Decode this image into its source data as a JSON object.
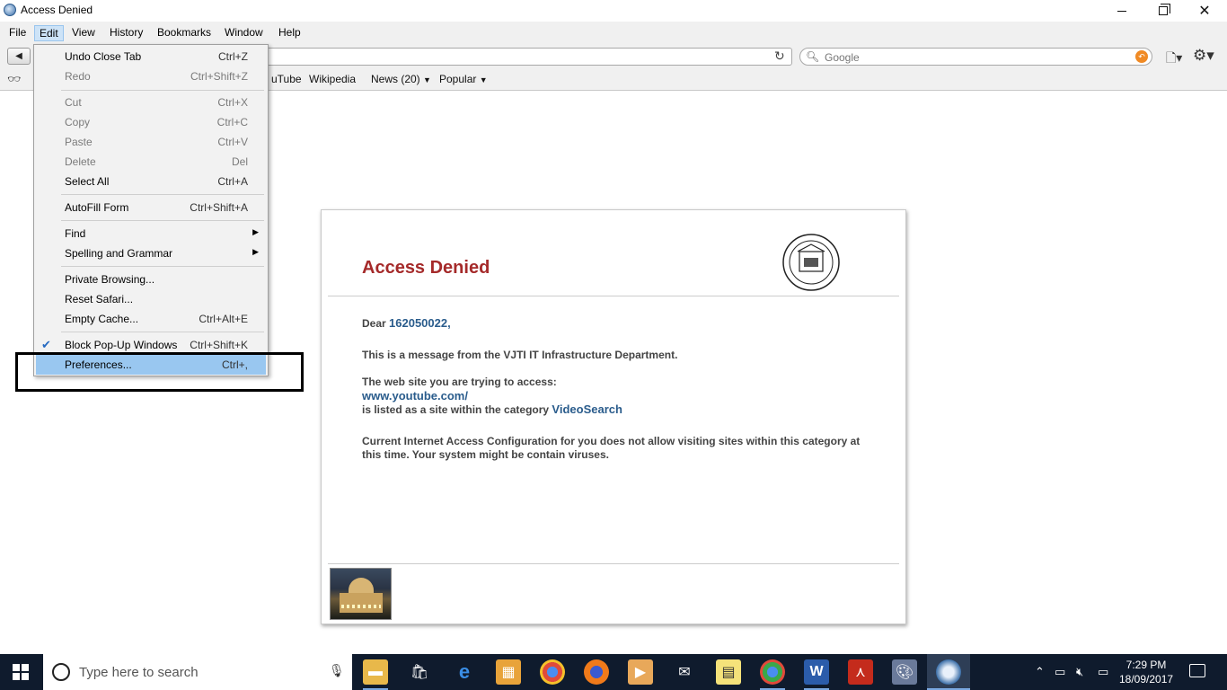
{
  "window": {
    "title": "Access Denied"
  },
  "menubar": {
    "items": [
      "File",
      "Edit",
      "View",
      "History",
      "Bookmarks",
      "Window",
      "Help"
    ],
    "active": "Edit"
  },
  "toolbar": {
    "search_placeholder": "Google"
  },
  "bookmarks": {
    "items": [
      "YouTube",
      "Wikipedia",
      "News (20)",
      "Popular"
    ],
    "partial_first_visible": "uTube"
  },
  "edit_menu": {
    "items": [
      {
        "label": "Undo Close Tab",
        "shortcut": "Ctrl+Z",
        "enabled": true
      },
      {
        "label": "Redo",
        "shortcut": "Ctrl+Shift+Z",
        "enabled": false
      },
      {
        "label": "Cut",
        "shortcut": "Ctrl+X",
        "enabled": false
      },
      {
        "label": "Copy",
        "shortcut": "Ctrl+C",
        "enabled": false
      },
      {
        "label": "Paste",
        "shortcut": "Ctrl+V",
        "enabled": false
      },
      {
        "label": "Delete",
        "shortcut": "Del",
        "enabled": false
      },
      {
        "label": "Select All",
        "shortcut": "Ctrl+A",
        "enabled": true
      },
      {
        "label": "AutoFill Form",
        "shortcut": "Ctrl+Shift+A",
        "enabled": true
      },
      {
        "label": "Find",
        "shortcut": "",
        "enabled": true,
        "submenu": true
      },
      {
        "label": "Spelling and Grammar",
        "shortcut": "",
        "enabled": true,
        "submenu": true
      },
      {
        "label": "Private Browsing...",
        "shortcut": "",
        "enabled": true
      },
      {
        "label": "Reset Safari...",
        "shortcut": "",
        "enabled": true
      },
      {
        "label": "Empty Cache...",
        "shortcut": "Ctrl+Alt+E",
        "enabled": true
      },
      {
        "label": "Block Pop-Up Windows",
        "shortcut": "Ctrl+Shift+K",
        "enabled": true,
        "checked": true
      },
      {
        "label": "Preferences...",
        "shortcut": "Ctrl+,",
        "enabled": true,
        "highlighted": true
      }
    ]
  },
  "page": {
    "heading": "Access Denied",
    "dear_prefix": "Dear",
    "user_id": "162050022,",
    "message_line": "This is a message from the VJTI IT Infrastructure Department.",
    "site_intro": "The web site you are trying to access:",
    "site_url": "www.youtube.com/",
    "category_prefix": "is listed as a site within the category",
    "category": "VideoSearch",
    "config_text": "Current Internet Access Configuration for you does not allow visiting sites within this category at this time. Your system might be contain viruses."
  },
  "taskbar": {
    "search_placeholder": "Type here to search",
    "time": "7:29 PM",
    "date": "18/09/2017"
  },
  "colors": {
    "heading": "#a52a2a",
    "link": "#2a5c8c",
    "menu_highlight": "#99c7f0",
    "taskbar": "#0f1b2d"
  }
}
